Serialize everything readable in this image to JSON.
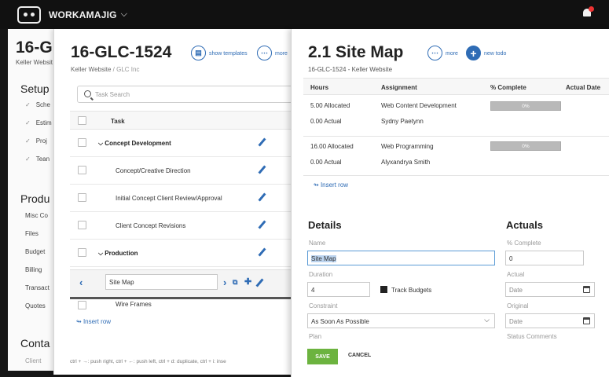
{
  "topbar": {
    "brand": "WORKAMAJIG"
  },
  "panel1": {
    "title": "16-G",
    "subtitle": "Keller Websit",
    "setup_heading": "Setup",
    "setup_items": [
      "Sche",
      "Estim",
      "Proj",
      "Tean"
    ],
    "products_heading": "Produ",
    "product_items": [
      "Misc Co",
      "Files",
      "Budget",
      "Billing",
      "Transact",
      "Quotes"
    ],
    "contacts_heading": "Conta",
    "contacts_items": [
      "Client"
    ]
  },
  "panel2": {
    "title": "16-GLC-1524",
    "subtitle_project": "Keller Website",
    "subtitle_sep": " / ",
    "subtitle_client": "GLC Inc",
    "show_templates_label": "show templates",
    "more_label": "more",
    "search_placeholder": "Task Search",
    "task_header": "Task",
    "rows": [
      {
        "label": "Concept Development",
        "group": true
      },
      {
        "label": "Concept/Creative Direction",
        "group": false
      },
      {
        "label": "Initial Concept Client Review/Approval",
        "group": false
      },
      {
        "label": "Client Concept Revisions",
        "group": false
      },
      {
        "label": "Production",
        "group": true
      }
    ],
    "edit_value": "Site Map",
    "next_row_label": "Wire Frames",
    "insert_row": "Insert row",
    "shortcuts": "ctrl + →: push right, ctrl + ←: push left, ctrl + d: duplicate, ctrl + i: inse"
  },
  "panel3": {
    "title": "2.1 Site Map",
    "subtitle": "16-GLC-1524 - Keller Website",
    "more_label": "more",
    "new_todo_label": "new todo",
    "headers": {
      "hours": "Hours",
      "assignment": "Assignment",
      "complete": "% Complete",
      "actual_date": "Actual Date"
    },
    "assignments": [
      {
        "allocated": "5.00 Allocated",
        "actual": "0.00 Actual",
        "task": "Web Content Development",
        "person": "Sydny Paetynn",
        "pct_label": "0%",
        "pct": 0
      },
      {
        "allocated": "16.00 Allocated",
        "actual": "0.00 Actual",
        "task": "Web Programming",
        "person": "Alyxandrya Smith",
        "pct_label": "0%",
        "pct": 0
      }
    ],
    "insert_row": "Insert row",
    "details": {
      "heading": "Details",
      "name_label": "Name",
      "name_value": "Site Map",
      "duration_label": "Duration",
      "duration_value": "4",
      "track_budgets": "Track Budgets",
      "constraint_label": "Constraint",
      "constraint_value": "As Soon As Possible",
      "plan_label": "Plan"
    },
    "actuals": {
      "heading": "Actuals",
      "complete_label": "% Complete",
      "complete_value": "0",
      "actual_label": "Actual",
      "actual_placeholder": "Date",
      "original_label": "Original",
      "original_placeholder": "Date",
      "status_label": "Status Comments"
    },
    "save_label": "SAVE",
    "cancel_label": "CANCEL"
  }
}
